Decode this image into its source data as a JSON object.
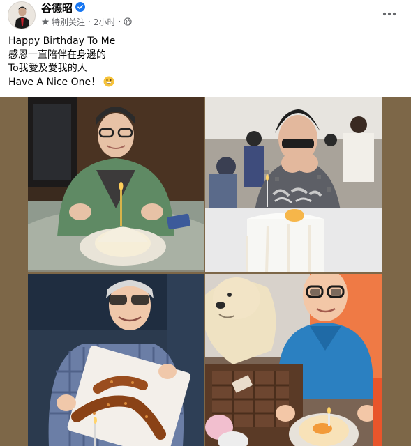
{
  "post": {
    "author": "谷德昭",
    "meta": {
      "following_label": "特別关注",
      "separator": "·",
      "time": "2小时"
    },
    "caption": [
      "Happy Birthday To Me",
      "感恩一直陪伴在身邊的",
      "To我愛及愛我的人",
      "Have A Nice One！"
    ],
    "icons": {
      "avatar": "profile-avatar",
      "verified": "verified-badge-icon",
      "star": "star-icon",
      "audience": "globe-icon",
      "more": "more-options-icon",
      "emoji": "grinning-emoji"
    },
    "colors": {
      "verified": "#1877f2",
      "meta_text": "#65676b",
      "gallery_background": "#7d6748"
    }
  }
}
